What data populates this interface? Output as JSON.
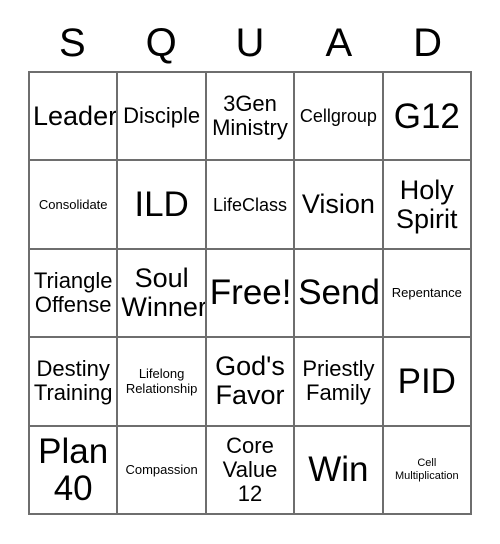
{
  "card": {
    "header": {
      "letters": [
        "S",
        "Q",
        "U",
        "A",
        "D"
      ]
    },
    "grid": {
      "columns": 5,
      "rows": 5,
      "cells": [
        {
          "text": "Leader",
          "size": "lg"
        },
        {
          "text": "Disciple",
          "size": "md"
        },
        {
          "text": "3Gen\nMinistry",
          "size": "md"
        },
        {
          "text": "Cellgroup",
          "size": "sm"
        },
        {
          "text": "G12",
          "size": "xl"
        },
        {
          "text": "Consolidate",
          "size": "xs"
        },
        {
          "text": "ILD",
          "size": "xl"
        },
        {
          "text": "LifeClass",
          "size": "sm"
        },
        {
          "text": "Vision",
          "size": "lg"
        },
        {
          "text": "Holy\nSpirit",
          "size": "lg"
        },
        {
          "text": "Triangle\nOffense",
          "size": "md"
        },
        {
          "text": "Soul\nWinner",
          "size": "lg"
        },
        {
          "text": "Free!",
          "size": "xl"
        },
        {
          "text": "Send",
          "size": "xl"
        },
        {
          "text": "Repentance",
          "size": "xs"
        },
        {
          "text": "Destiny\nTraining",
          "size": "md"
        },
        {
          "text": "Lifelong\nRelationship",
          "size": "xs"
        },
        {
          "text": "God's\nFavor",
          "size": "lg"
        },
        {
          "text": "Priestly\nFamily",
          "size": "md"
        },
        {
          "text": "PID",
          "size": "xl"
        },
        {
          "text": "Plan\n40",
          "size": "xl"
        },
        {
          "text": "Compassion",
          "size": "xs"
        },
        {
          "text": "Core\nValue\n12",
          "size": "md"
        },
        {
          "text": "Win",
          "size": "xl"
        },
        {
          "text": "Cell\nMultiplication",
          "size": "xxs"
        }
      ]
    },
    "colors": {
      "background": "#ffffff",
      "text": "#000000",
      "grid_line": "#6e6e6e"
    }
  }
}
